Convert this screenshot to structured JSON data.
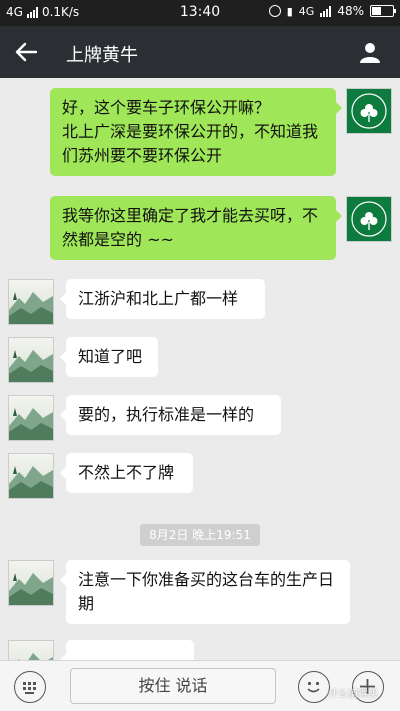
{
  "status_bar": {
    "network": "4G",
    "speed": "0.1K/s",
    "time": "13:40",
    "network2": "4G",
    "battery": "48%",
    "battery_level": 0.48
  },
  "header": {
    "title": "上牌黄牛"
  },
  "messages": [
    {
      "sender": "me",
      "text": "好，这个要车子环保公开嘛？\n北上广深是要环保公开的，不知道我们苏州要不要环保公开",
      "avatar": "celtics-logo"
    },
    {
      "sender": "me",
      "text": "我等你这里确定了我才能去买呀，不然都是空的 ~~",
      "avatar": "celtics-logo"
    },
    {
      "sender": "other",
      "text": "江浙沪和北上广都一样",
      "avatar": "landscape-painting"
    },
    {
      "sender": "other",
      "text": "知道了吧",
      "avatar": "landscape-painting"
    },
    {
      "sender": "other",
      "text": "要的，执行标准是一样的",
      "avatar": "landscape-painting"
    },
    {
      "sender": "other",
      "text": "不然上不了牌",
      "avatar": "landscape-painting"
    },
    {
      "sender": "other",
      "text": "注意一下你准备买的这台车的生产日期",
      "avatar": "landscape-painting"
    }
  ],
  "timestamp_divider": "8月2日 晚上19:51",
  "input_bar": {
    "talk_label": "按住 说话"
  },
  "watermark": "什么值得买",
  "colors": {
    "title_bar": "#2b2e33",
    "my_bubble": "#9fe658",
    "their_bubble": "#ffffff",
    "background": "#ebebeb"
  }
}
